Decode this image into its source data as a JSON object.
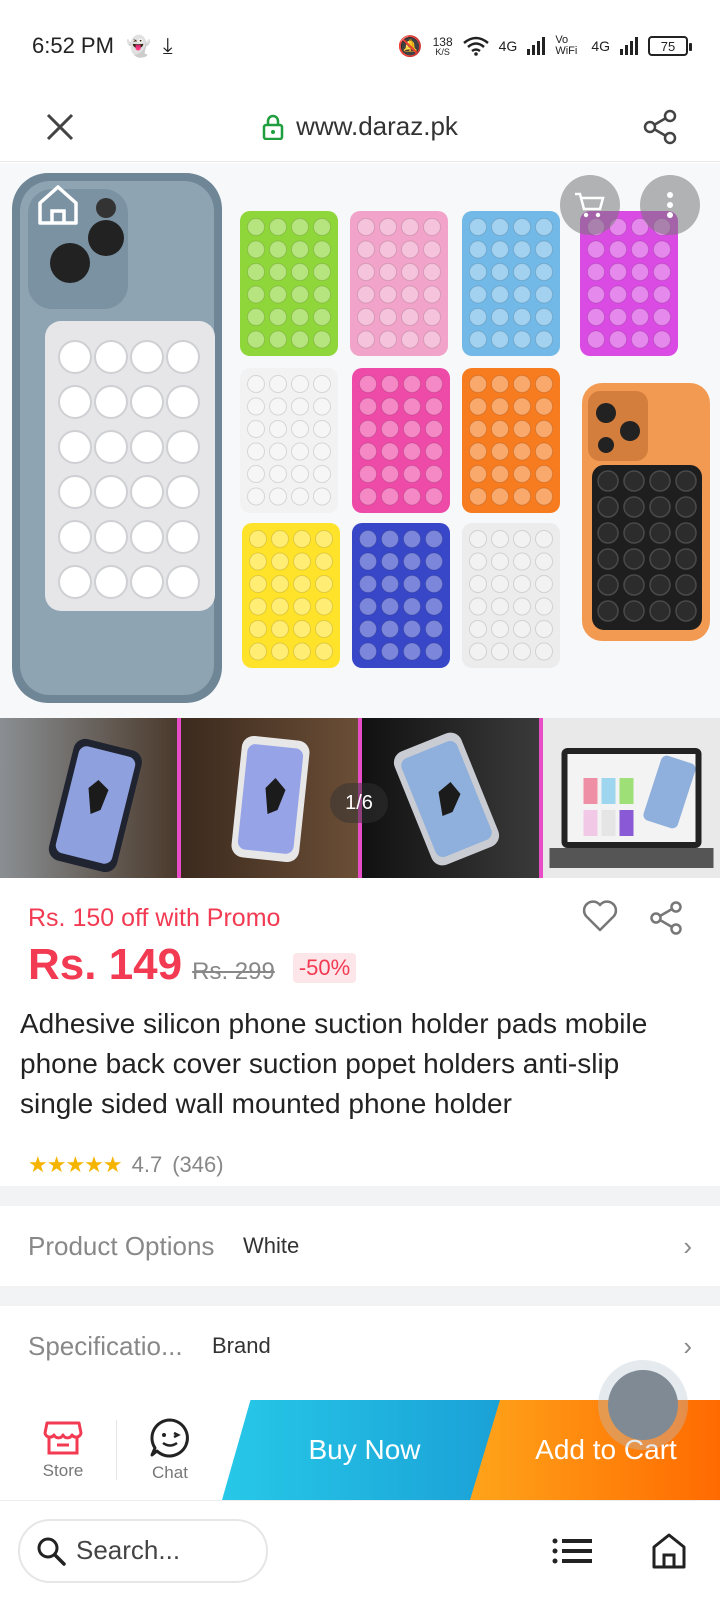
{
  "status": {
    "time": "6:52 PM",
    "net_speed": "138",
    "net_unit": "K/S",
    "signal1": "4G",
    "volte": "Vo WiFi",
    "signal2": "4G",
    "battery": "75"
  },
  "browser": {
    "url": "www.daraz.pk"
  },
  "gallery": {
    "counter": "1/6",
    "pad_colors": [
      "#8fd63a",
      "#f2a3c9",
      "#72b9e8",
      "#d94be3",
      "#f2f2f2",
      "#ee4aa8",
      "#f77b1f",
      "#ffe32a",
      "#3747c8",
      "#ececec"
    ]
  },
  "product": {
    "promo": "Rs. 150 off with Promo",
    "price": "Rs. 149",
    "old_price": "Rs. 299",
    "discount": "-50%",
    "title": "Adhesive silicon phone suction holder pads mobile phone back cover suction popet holders anti-slip single sided wall mounted phone holder",
    "rating_value": "4.7",
    "rating_count": "(346)",
    "rating": 4.7
  },
  "options": {
    "product_options_label": "Product Options",
    "product_options_value": "White",
    "specifications_label": "Specificatio...",
    "specifications_value": "Brand"
  },
  "actions": {
    "store": "Store",
    "chat": "Chat",
    "buy_now": "Buy Now",
    "add_to_cart": "Add to Cart"
  },
  "bottom": {
    "search_placeholder": "Search..."
  },
  "colors": {
    "accent": "#f23b52",
    "buy_now": "#1aa0d6",
    "add_to_cart": "#ff6a00",
    "secure": "#1e9e3e"
  }
}
